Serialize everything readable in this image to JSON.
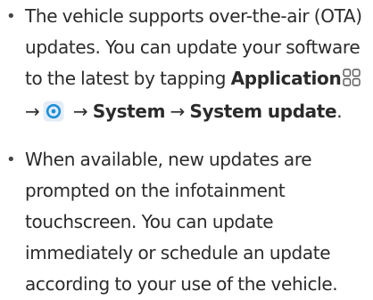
{
  "bullet_glyph": "•",
  "icons": {
    "grid": "application-grid-icon",
    "app": "settings-app-icon"
  },
  "colors": {
    "text": "#2b2b2b",
    "app_icon_bg": "#e3ecf6",
    "app_icon_fg": "#1a8fd6"
  },
  "items": [
    {
      "line1": "The vehicle supports over-the-air (OTA)",
      "line2": "updates. You can update your software",
      "line3_pre": "to the latest by tapping ",
      "line3_bold": "Application",
      "line4_arrow1": "→",
      "line4_arrow2": " → ",
      "line4_bold1": "System",
      "line4_arrow3": " → ",
      "line4_bold2": "System update",
      "line4_end": "."
    },
    {
      "line1": "When available, new updates are",
      "line2": "prompted on the infotainment",
      "line3": "touchscreen. You can update",
      "line4": "immediately or schedule an update",
      "line5": "according to your use of the vehicle."
    }
  ]
}
